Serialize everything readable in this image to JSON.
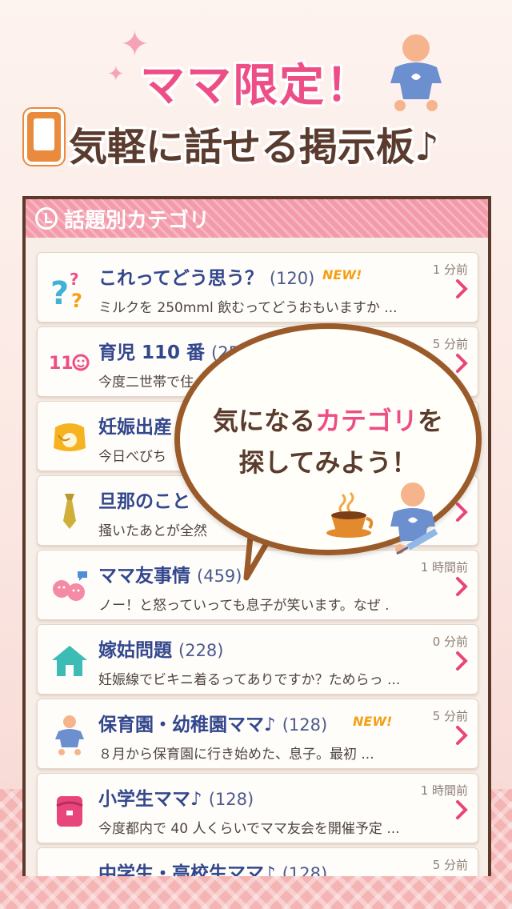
{
  "promo": {
    "headline": "ママ限定！",
    "subline": "気軽に話せる掲示板♪"
  },
  "panel": {
    "title": "話題別カテゴリ"
  },
  "categories": [
    {
      "title": "これってどう思う？",
      "count": "(120)",
      "badge": "NEW!",
      "time": "1 分前",
      "snippet": "ミルクを 250mml 飲むってどうおもいますか ...",
      "icon": "question-marks-icon"
    },
    {
      "title": "育児 110 番",
      "count": "(25",
      "badge": "",
      "time": "5 分前",
      "snippet": "今度二世帯で住",
      "icon": "emergency-110-icon"
    },
    {
      "title": "妊娠出産",
      "count": "",
      "badge": "",
      "time": "",
      "snippet": "今日べびち",
      "icon": "pregnant-belly-icon"
    },
    {
      "title": "旦那のこと",
      "count": "",
      "badge": "",
      "time": "",
      "snippet": "掻いたあとが全然",
      "icon": "necktie-icon"
    },
    {
      "title": "ママ友事情",
      "count": "(459)",
      "badge": "",
      "time": "1 時間前",
      "snippet": "ノー！と怒っていっても息子が笑います。なぜ .",
      "icon": "chat-faces-icon"
    },
    {
      "title": "嫁姑問題",
      "count": "(228)",
      "badge": "",
      "time": "0 分前",
      "snippet": "妊娠線でビキニ着るってありですか？ためらっ ...",
      "icon": "house-icon"
    },
    {
      "title": "保育園・幼稚園ママ♪",
      "count": "(128)",
      "badge": "NEW!",
      "time": "5 分前",
      "snippet": "８月から保育園に行き始めた、息子。最初 ...",
      "icon": "baby-icon"
    },
    {
      "title": "小学生ママ♪",
      "count": "(128)",
      "badge": "",
      "time": "1 時間前",
      "snippet": "今度都内で 40 人くらいでママ友会を開催予定 ...",
      "icon": "school-bag-icon"
    },
    {
      "title": "中学生・高校生ママ♪",
      "count": "(128)",
      "badge": "",
      "time": "5 分前",
      "snippet": "",
      "icon": "uniform-icon"
    }
  ],
  "bubble": {
    "line1_pre": "気になる",
    "line1_highlight": "カテゴリ",
    "line1_post": "を",
    "line2": "探してみよう！"
  },
  "colors": {
    "accent_pink": "#ee4e86",
    "title_blue": "#33478d",
    "badge_orange": "#f4a015",
    "chevron_pink": "#e8457c",
    "frame_brown": "#5c3a2b"
  }
}
